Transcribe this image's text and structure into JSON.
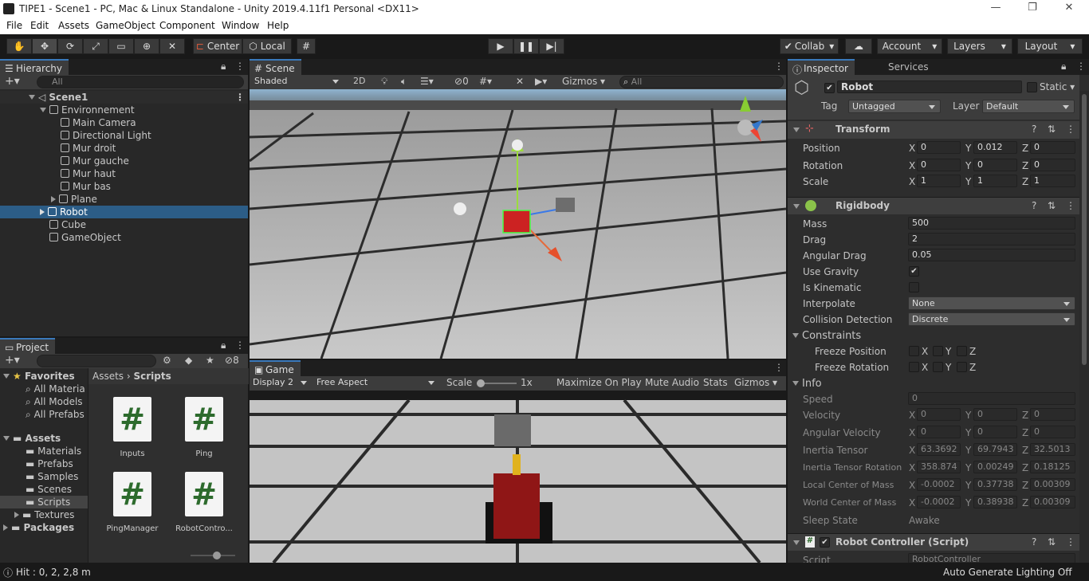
{
  "window": {
    "title": "TIPE1 - Scene1 - PC, Mac & Linux Standalone - Unity 2019.4.11f1 Personal <DX11>",
    "minimize": "—",
    "restore": "❐",
    "close": "✕"
  },
  "menu": [
    "File",
    "Edit",
    "Assets",
    "GameObject",
    "Component",
    "Window",
    "Help"
  ],
  "toolbar": {
    "pivot": "Center",
    "space": "Local",
    "collab": "Collab",
    "account": "Account",
    "layers": "Layers",
    "layout": "Layout"
  },
  "hierarchy": {
    "tab": "Hierarchy",
    "search_placeholder": "All",
    "scene": "Scene1",
    "items": [
      "Environnement",
      "Main Camera",
      "Directional Light",
      "Mur droit",
      "Mur gauche",
      "Mur haut",
      "Mur bas",
      "Plane",
      "Robot",
      "Cube",
      "GameObject"
    ]
  },
  "project": {
    "tab": "Project",
    "count": "8",
    "breadcrumb_root": "Assets",
    "breadcrumb_leaf": "Scripts",
    "favorites": "Favorites",
    "fav_items": [
      "All Materia",
      "All Models",
      "All Prefabs"
    ],
    "assets_root": "Assets",
    "folders": [
      "Materials",
      "Prefabs",
      "Samples",
      "Scenes",
      "Scripts",
      "Textures"
    ],
    "packages": "Packages",
    "files": [
      "Inputs",
      "Ping",
      "PingManager",
      "RobotContro..."
    ],
    "script_glyph": "#"
  },
  "scene": {
    "tab": "Scene",
    "shading": "Shaded",
    "mode2d": "2D",
    "hidden_count": "0",
    "gizmos": "Gizmos",
    "search_placeholder": "All"
  },
  "game": {
    "tab": "Game",
    "display": "Display 2",
    "aspect": "Free Aspect",
    "scale_label": "Scale",
    "scale_value": "1x",
    "maximize": "Maximize On Play",
    "mute": "Mute Audio",
    "stats": "Stats",
    "gizmos": "Gizmos"
  },
  "inspector": {
    "tab": "Inspector",
    "tab2": "Services",
    "name": "Robot",
    "static": "Static",
    "tag_label": "Tag",
    "tag": "Untagged",
    "layer_label": "Layer",
    "layer": "Default",
    "transform": {
      "title": "Transform",
      "position": {
        "label": "Position",
        "x": "0",
        "y": "0.012",
        "z": "0"
      },
      "rotation": {
        "label": "Rotation",
        "x": "0",
        "y": "0",
        "z": "0"
      },
      "scale": {
        "label": "Scale",
        "x": "1",
        "y": "1",
        "z": "1"
      }
    },
    "rigidbody": {
      "title": "Rigidbody",
      "mass_label": "Mass",
      "mass": "500",
      "drag_label": "Drag",
      "drag": "2",
      "angular_label": "Angular Drag",
      "angular": "0.05",
      "gravity_label": "Use Gravity",
      "kinematic_label": "Is Kinematic",
      "interp_label": "Interpolate",
      "interp": "None",
      "coll_label": "Collision Detection",
      "coll": "Discrete",
      "constraints": "Constraints",
      "freeze_pos": "Freeze Position",
      "freeze_rot": "Freeze Rotation",
      "info": "Info",
      "speed_label": "Speed",
      "speed": "0",
      "vel_label": "Velocity",
      "vel": {
        "x": "0",
        "y": "0",
        "z": "0"
      },
      "angvel_label": "Angular Velocity",
      "angvel": {
        "x": "0",
        "y": "0",
        "z": "0"
      },
      "it_label": "Inertia Tensor",
      "it": {
        "x": "63.3692",
        "y": "69.7943",
        "z": "32.5013"
      },
      "itr_label": "Inertia Tensor Rotation",
      "itr": {
        "x": "358.874",
        "y": "0.00249",
        "z": "0.18125"
      },
      "lcm_label": "Local Center of Mass",
      "lcm": {
        "x": "-0.0002",
        "y": "0.37738",
        "z": "0.00309"
      },
      "wcm_label": "World Center of Mass",
      "wcm": {
        "x": "-0.0002",
        "y": "0.38938",
        "z": "0.00309"
      },
      "sleep_label": "Sleep State",
      "sleep": "Awake"
    },
    "script": {
      "title": "Robot Controller (Script)",
      "label": "Script",
      "value": "RobotController"
    }
  },
  "status": {
    "left": "Hit : 0, 2, 2,8 m",
    "right": "Auto Generate Lighting Off"
  }
}
